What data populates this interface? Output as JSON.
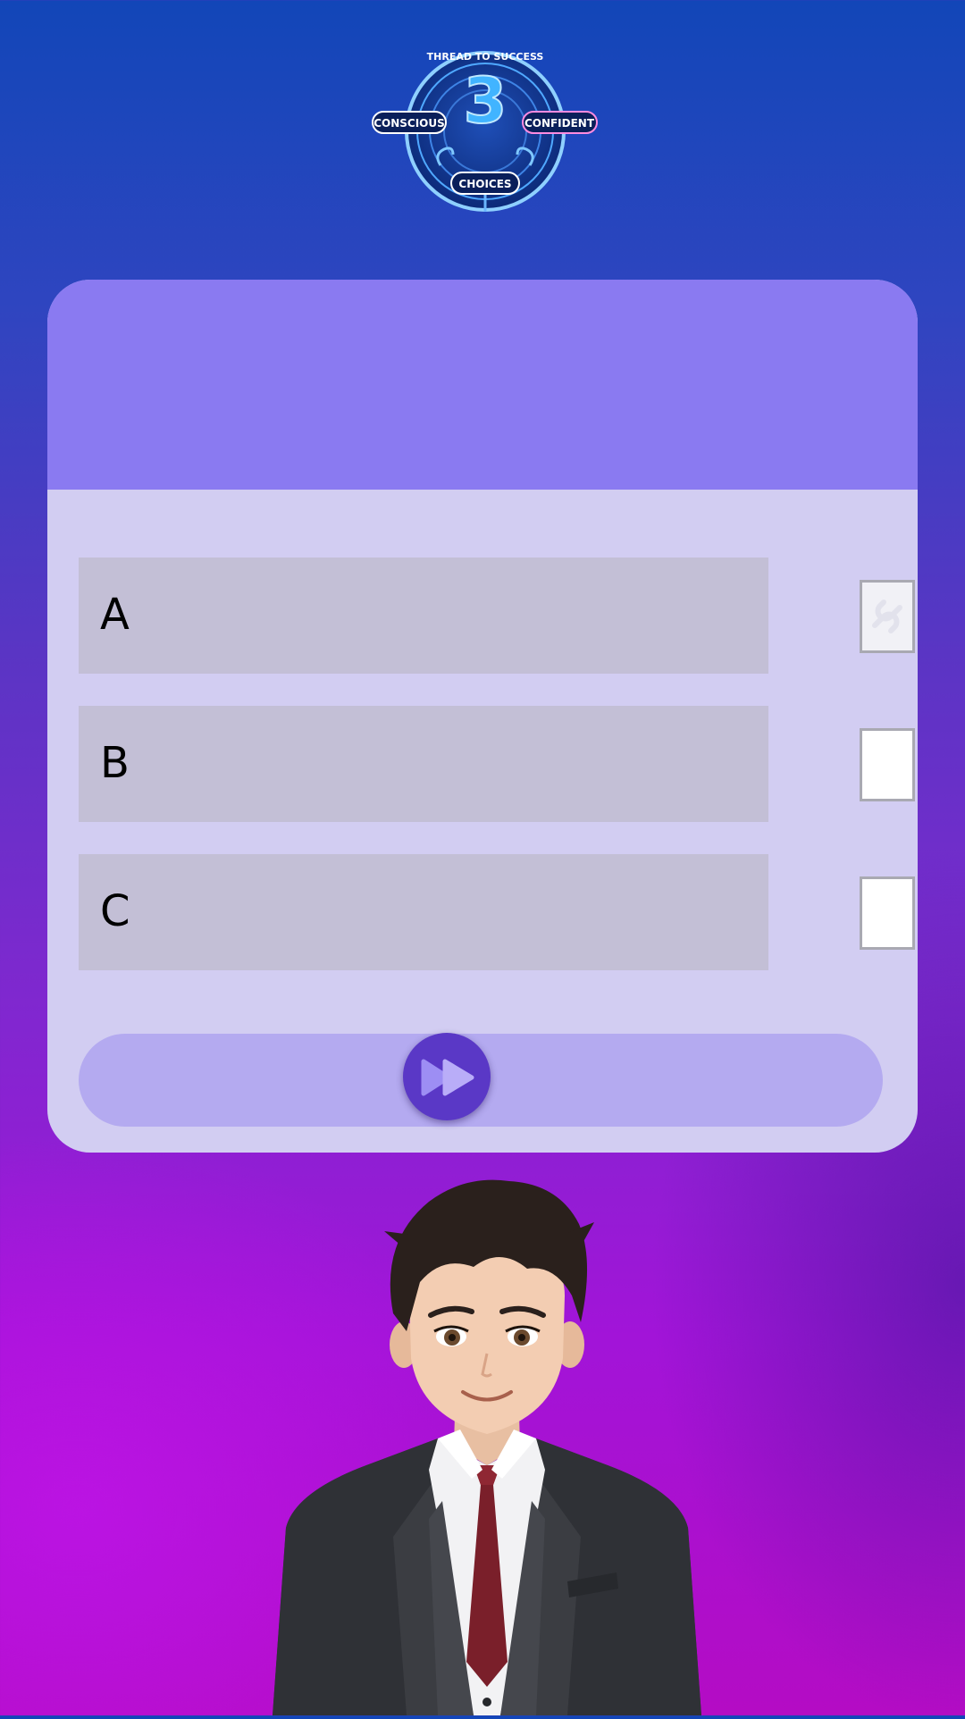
{
  "logo": {
    "arc_text": "THREAD TO SUCCESS",
    "numeral": "3",
    "left_label": "CONSCIOUS",
    "right_label": "CONFIDENT",
    "bottom_label": "CHOICES"
  },
  "quiz": {
    "question": "",
    "options": [
      {
        "label": "A",
        "checkbox_state": "disabled"
      },
      {
        "label": "B",
        "checkbox_state": "empty"
      },
      {
        "label": "C",
        "checkbox_state": "empty"
      }
    ],
    "next_icon": "fast-forward-icon"
  },
  "colors": {
    "header": "#8a7af1",
    "card": "#d2cdf2",
    "option_bg": "#c3bfd6",
    "next_bar": "#b4aaf0",
    "next_button": "#5a38c6"
  }
}
